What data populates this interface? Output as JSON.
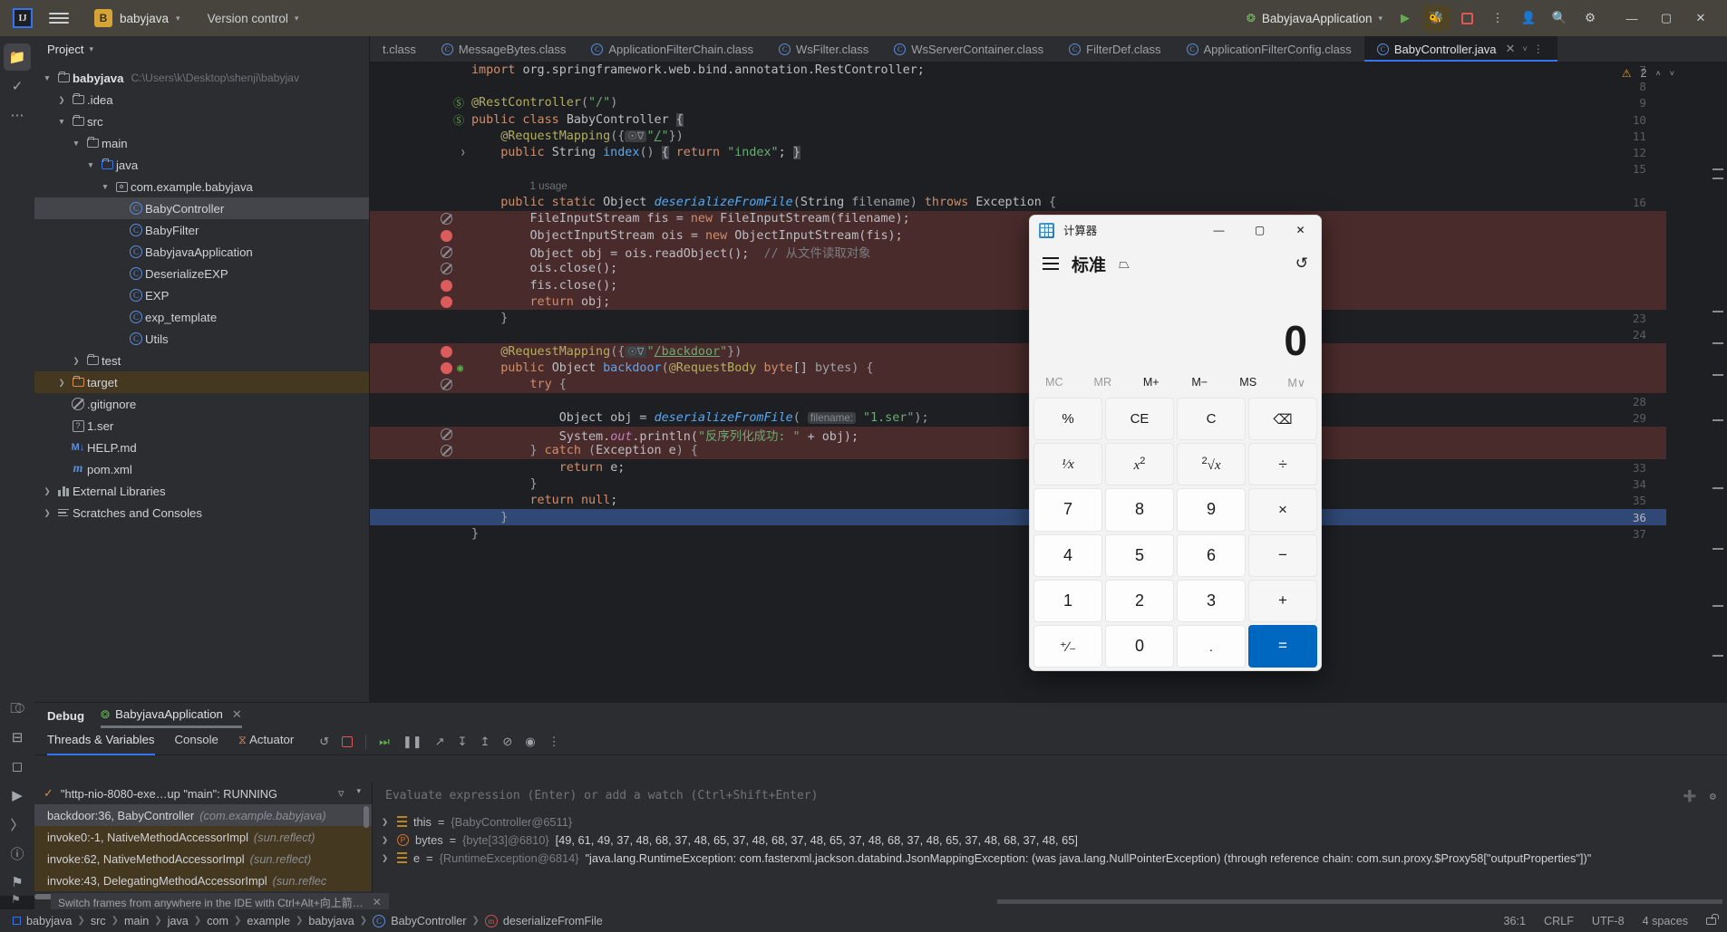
{
  "toolbar": {
    "logo": "IJ",
    "project_badge": "B",
    "project_name": "babyjava",
    "version_control": "Version control",
    "run_config": "BabyjavaApplication",
    "icons": [
      "hamburger-icon",
      "run-icon",
      "coverage-icon",
      "stop-icon",
      "more-icon",
      "account-icon",
      "search-icon",
      "settings-icon"
    ],
    "window_buttons": [
      "minimize",
      "maximize",
      "close"
    ]
  },
  "activity_bar": {
    "items": [
      "project-icon",
      "commit-icon",
      "more-tools-icon",
      "structure-icon",
      "terminal-icon",
      "services-icon",
      "run-icon",
      "debug-icon",
      "problems-icon",
      "notifications-icon"
    ]
  },
  "project_panel": {
    "title": "Project",
    "tree": [
      {
        "depth": 0,
        "arrow": "v",
        "icon": "module-folder",
        "label": "babyjava",
        "path": "C:\\Users\\k\\Desktop\\shenji\\babyjav",
        "bold": true
      },
      {
        "depth": 1,
        "arrow": ">",
        "icon": "folder",
        "label": ".idea"
      },
      {
        "depth": 1,
        "arrow": "v",
        "icon": "folder",
        "label": "src"
      },
      {
        "depth": 2,
        "arrow": "v",
        "icon": "folder",
        "label": "main"
      },
      {
        "depth": 3,
        "arrow": "v",
        "icon": "folder-blue",
        "label": "java"
      },
      {
        "depth": 4,
        "arrow": "v",
        "icon": "package",
        "label": "com.example.babyjava"
      },
      {
        "depth": 5,
        "arrow": "none",
        "icon": "class",
        "label": "BabyController",
        "state": "selected"
      },
      {
        "depth": 5,
        "arrow": "none",
        "icon": "class",
        "label": "BabyFilter"
      },
      {
        "depth": 5,
        "arrow": "none",
        "icon": "class",
        "label": "BabyjavaApplication"
      },
      {
        "depth": 5,
        "arrow": "none",
        "icon": "class",
        "label": "DeserializeEXP"
      },
      {
        "depth": 5,
        "arrow": "none",
        "icon": "class",
        "label": "EXP"
      },
      {
        "depth": 5,
        "arrow": "none",
        "icon": "class",
        "label": "exp_template"
      },
      {
        "depth": 5,
        "arrow": "none",
        "icon": "class",
        "label": "Utils"
      },
      {
        "depth": 2,
        "arrow": ">",
        "icon": "folder",
        "label": "test"
      },
      {
        "depth": 1,
        "arrow": ">",
        "icon": "folder-orange",
        "label": "target",
        "state": "highlight"
      },
      {
        "depth": 1,
        "arrow": "none",
        "icon": "ignored",
        "label": ".gitignore"
      },
      {
        "depth": 1,
        "arrow": "none",
        "icon": "unknown",
        "label": "1.ser"
      },
      {
        "depth": 1,
        "arrow": "none",
        "icon": "markdown",
        "label": "HELP.md"
      },
      {
        "depth": 1,
        "arrow": "none",
        "icon": "maven",
        "label": "pom.xml"
      },
      {
        "depth": 0,
        "arrow": ">",
        "icon": "libraries",
        "label": "External Libraries"
      },
      {
        "depth": 0,
        "arrow": ">",
        "icon": "scratches",
        "label": "Scratches and Consoles"
      }
    ]
  },
  "editor": {
    "tabs": [
      {
        "label": "t.class",
        "icon": "class",
        "active": false,
        "clipped": true
      },
      {
        "label": "MessageBytes.class",
        "icon": "class",
        "active": false
      },
      {
        "label": "ApplicationFilterChain.class",
        "icon": "class",
        "active": false
      },
      {
        "label": "WsFilter.class",
        "icon": "class",
        "active": false
      },
      {
        "label": "WsServerContainer.class",
        "icon": "class",
        "active": false
      },
      {
        "label": "FilterDef.class",
        "icon": "class",
        "active": false
      },
      {
        "label": "ApplicationFilterConfig.class",
        "icon": "class",
        "active": false
      },
      {
        "label": "BabyController.java",
        "icon": "class",
        "active": true
      }
    ],
    "warning_count": "2",
    "usage_hint": "1 usage",
    "param_hint": "filename:",
    "lines": [
      {
        "n": 7,
        "marker": null,
        "hl": false
      },
      {
        "n": 8,
        "marker": null,
        "hl": false
      },
      {
        "n": 9,
        "marker": "run-ok",
        "hl": false
      },
      {
        "n": 10,
        "marker": "run-ok",
        "hl": false
      },
      {
        "n": 11,
        "marker": null,
        "hl": false
      },
      {
        "n": 12,
        "marker": "fold",
        "hl": false
      },
      {
        "n": 15,
        "marker": null,
        "hl": false
      },
      {
        "n": null,
        "marker": null,
        "hl": false
      },
      {
        "n": 16,
        "marker": null,
        "hl": false
      },
      {
        "n": null,
        "marker": "bp-dis",
        "hl": true
      },
      {
        "n": null,
        "marker": "bp",
        "hl": true
      },
      {
        "n": null,
        "marker": "bp-dis",
        "hl": true
      },
      {
        "n": null,
        "marker": "bp-dis",
        "hl": true
      },
      {
        "n": null,
        "marker": "bp",
        "hl": true
      },
      {
        "n": null,
        "marker": "bp",
        "hl": true
      },
      {
        "n": 23,
        "marker": null,
        "hl": false
      },
      {
        "n": 24,
        "marker": null,
        "hl": false
      },
      {
        "n": null,
        "marker": "bp",
        "hl": true
      },
      {
        "n": null,
        "marker": "bp-run",
        "hl": true
      },
      {
        "n": null,
        "marker": "bp-dis",
        "hl": true
      },
      {
        "n": 28,
        "marker": null,
        "hl": false
      },
      {
        "n": 29,
        "marker": null,
        "hl": false
      },
      {
        "n": null,
        "marker": "bp-dis",
        "hl": true
      },
      {
        "n": null,
        "marker": "bp-dis",
        "hl": true
      },
      {
        "n": 33,
        "marker": null,
        "hl": false
      },
      {
        "n": 34,
        "marker": null,
        "hl": false
      },
      {
        "n": 35,
        "marker": null,
        "hl": false
      },
      {
        "n": 36,
        "marker": null,
        "hl": false,
        "current": true
      },
      {
        "n": 37,
        "marker": null,
        "hl": false
      }
    ]
  },
  "debug": {
    "tab_debug": "Debug",
    "tab_app": "BabyjavaApplication",
    "subtabs": [
      "Threads & Variables",
      "Console",
      "Actuator"
    ],
    "thread": "\"http-nio-8080-exe…up \"main\": RUNNING",
    "frames": [
      {
        "name": "backdoor:36, BabyController",
        "loc": "(com.example.babyjava)",
        "state": "selected"
      },
      {
        "name": "invoke0:-1, NativeMethodAccessorImpl",
        "loc": "(sun.reflect)",
        "state": "lib"
      },
      {
        "name": "invoke:62, NativeMethodAccessorImpl",
        "loc": "(sun.reflect)",
        "state": "lib"
      },
      {
        "name": "invoke:43, DelegatingMethodAccessorImpl",
        "loc": "(sun.reflec",
        "state": "lib"
      }
    ],
    "eval_placeholder": "Evaluate expression (Enter) or add a watch (Ctrl+Shift+Enter)",
    "variables": [
      {
        "icon": "object-icon",
        "name": "this",
        "ref": "{BabyController@6511}",
        "value": ""
      },
      {
        "icon": "param-icon",
        "name": "bytes",
        "ref": "{byte[33]@6810}",
        "value": "[49, 61, 49, 37, 48, 68, 37, 48, 65, 37, 48, 68, 37, 48, 65, 37, 48, 68, 37, 48, 65, 37, 48, 68, 37, 48, 65]"
      },
      {
        "icon": "object-icon",
        "name": "e",
        "ref": "{RuntimeException@6814}",
        "value": "\"java.lang.RuntimeException: com.fasterxml.jackson.databind.JsonMappingException: (was java.lang.NullPointerException) (through reference chain: com.sun.proxy.$Proxy58[\"outputProperties\"])\""
      }
    ]
  },
  "tip": {
    "text": "Switch frames from anywhere in the IDE with Ctrl+Alt+向上箭…"
  },
  "status_bar": {
    "breadcrumbs": [
      "babyjava",
      "src",
      "main",
      "java",
      "com",
      "example",
      "babyjava",
      "BabyController",
      "deserializeFromFile"
    ],
    "caret": "36:1",
    "line_sep": "CRLF",
    "encoding": "UTF-8",
    "indent": "4 spaces"
  },
  "calculator": {
    "window_title": "计算器",
    "mode": "标准",
    "display": "0",
    "memory": [
      "MC",
      "MR",
      "M+",
      "M−",
      "MS",
      "M"
    ],
    "memory_enabled": [
      false,
      false,
      true,
      true,
      true,
      false
    ],
    "keys": [
      {
        "label": "%",
        "kind": "fn",
        "name": "percent"
      },
      {
        "label": "CE",
        "kind": "fn",
        "name": "clear-entry"
      },
      {
        "label": "C",
        "kind": "fn",
        "name": "clear"
      },
      {
        "label": "⌫",
        "kind": "fn",
        "name": "backspace"
      },
      {
        "label": "1/x",
        "kind": "fn",
        "name": "reciprocal"
      },
      {
        "label": "x²",
        "kind": "fn",
        "name": "square"
      },
      {
        "label": "²√x",
        "kind": "fn",
        "name": "square-root"
      },
      {
        "label": "÷",
        "kind": "op",
        "name": "divide"
      },
      {
        "label": "7",
        "kind": "num",
        "name": "seven"
      },
      {
        "label": "8",
        "kind": "num",
        "name": "eight"
      },
      {
        "label": "9",
        "kind": "num",
        "name": "nine"
      },
      {
        "label": "×",
        "kind": "op",
        "name": "multiply"
      },
      {
        "label": "4",
        "kind": "num",
        "name": "four"
      },
      {
        "label": "5",
        "kind": "num",
        "name": "five"
      },
      {
        "label": "6",
        "kind": "num",
        "name": "six"
      },
      {
        "label": "−",
        "kind": "op",
        "name": "subtract"
      },
      {
        "label": "1",
        "kind": "num",
        "name": "one"
      },
      {
        "label": "2",
        "kind": "num",
        "name": "two"
      },
      {
        "label": "3",
        "kind": "num",
        "name": "three"
      },
      {
        "label": "+",
        "kind": "op",
        "name": "add"
      },
      {
        "label": "⁺∕₋",
        "kind": "num",
        "name": "plus-minus"
      },
      {
        "label": "0",
        "kind": "num",
        "name": "zero"
      },
      {
        "label": ".",
        "kind": "num",
        "name": "decimal"
      },
      {
        "label": "=",
        "kind": "eq",
        "name": "equals"
      }
    ],
    "window_buttons": [
      "—",
      "▢",
      "✕"
    ]
  }
}
